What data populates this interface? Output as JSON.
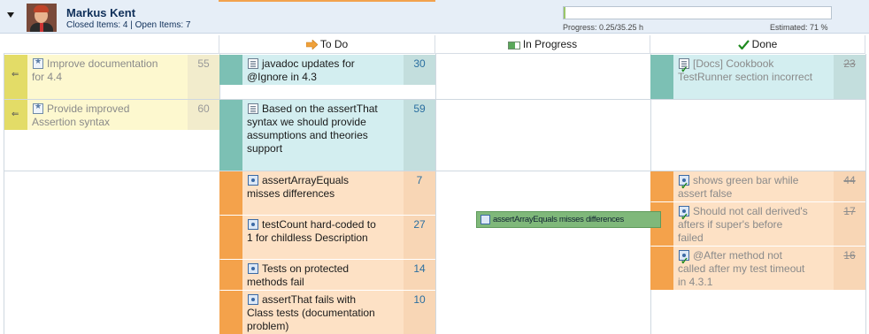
{
  "user": {
    "name": "Markus Kent",
    "item_counts": "Closed Items: 4 | Open Items: 7",
    "progress_text": "Progress: 0.25/35.25 h",
    "estimated_text": "Estimated: 71 %",
    "progress_fraction": 0.0071
  },
  "columns": {
    "left": "",
    "todo": "To Do",
    "in_progress": "In Progress",
    "done": "Done"
  },
  "icons": {
    "toggle": "chevron-down-icon",
    "todo": "arrow-right-icon",
    "in_progress": "progress-bar-icon",
    "done": "check-icon"
  },
  "cards": [
    {
      "id": "left1",
      "title": "Improve documentation for 4.4",
      "number": "55"
    },
    {
      "id": "left2",
      "title": "Provide improved Assertion syntax",
      "number": "60"
    },
    {
      "id": "todo1",
      "title": "javadoc updates for @Ignore in 4.3",
      "number": "30"
    },
    {
      "id": "todo2",
      "title": "Based on the assertThat syntax we should provide assumptions and theories support",
      "number": "59"
    },
    {
      "id": "done1",
      "title": "[Docs] Cookbook TestRunner section incorrect",
      "number": "23"
    },
    {
      "id": "todo3",
      "title": "assertArrayEquals misses differences",
      "number": "7"
    },
    {
      "id": "todo4",
      "title": "testCount hard-coded to 1 for childless Description",
      "number": "27"
    },
    {
      "id": "todo5",
      "title": "Tests on protected methods fail",
      "number": "14"
    },
    {
      "id": "todo6",
      "title": "assertThat fails with Class tests (documentation problem)",
      "number": "10"
    },
    {
      "id": "done2",
      "title": "shows green bar while assert false",
      "number": "44"
    },
    {
      "id": "done3",
      "title": "Should not call derived's afters if super's before failed",
      "number": "17"
    },
    {
      "id": "done4",
      "title": "@After method not called after my test timeout in 4.3.1",
      "number": "16"
    }
  ],
  "drag_preview": "assertArrayEquals misses differences",
  "colors": {
    "yellow_strip": "#e3dc67",
    "teal_strip": "#7cc0b4",
    "orange_strip": "#f4a24b",
    "drag": "#7fb87a"
  }
}
